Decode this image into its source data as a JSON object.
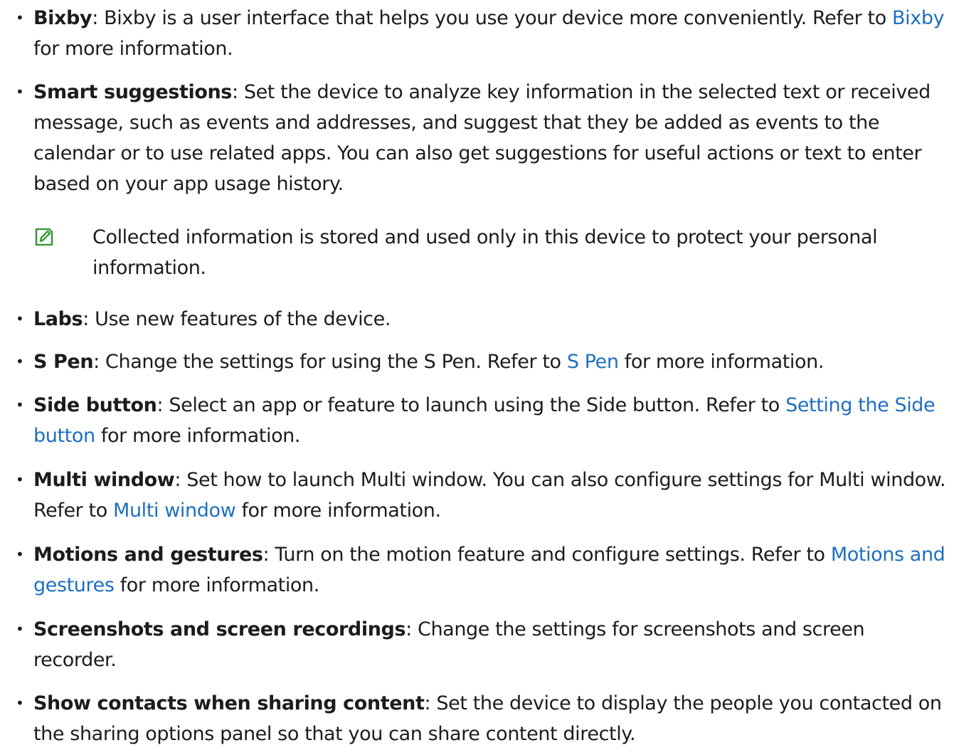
{
  "items": [
    {
      "term": "Bixby",
      "before": ": Bixby is a user interface that helps you use your device more conveniently. Refer to ",
      "link": "Bixby",
      "after": " for more information."
    },
    {
      "term": "Smart suggestions",
      "before": ": Set the device to analyze key information in the selected text or received message, such as events and addresses, and suggest that they be added as events to the calendar or to use related apps. You can also get suggestions for useful actions or text to enter based on your app usage history.",
      "link": "",
      "after": ""
    },
    {
      "term": "Labs",
      "before": ": Use new features of the device.",
      "link": "",
      "after": ""
    },
    {
      "term": "S Pen",
      "before": ": Change the settings for using the S Pen. Refer to ",
      "link": "S Pen",
      "after": " for more information."
    },
    {
      "term": "Side button",
      "before": ": Select an app or feature to launch using the Side button. Refer to ",
      "link": "Setting the Side button",
      "after": " for more information."
    },
    {
      "term": "Multi window",
      "before": ": Set how to launch Multi window. You can also configure settings for Multi window. Refer to ",
      "link": "Multi window",
      "after": " for more information."
    },
    {
      "term": "Motions and gestures",
      "before": ": Turn on the motion feature and configure settings. Refer to ",
      "link": "Motions and gestures",
      "after": " for more information."
    },
    {
      "term": "Screenshots and screen recordings",
      "before": ": Change the settings for screenshots and screen recorder.",
      "link": "",
      "after": ""
    },
    {
      "term": "Show contacts when sharing content",
      "before": ": Set the device to display the people you contacted on the sharing options panel so that you can share content directly.",
      "link": "",
      "after": ""
    }
  ],
  "note": {
    "icon": "note-pencil-icon",
    "text": "Collected information is stored and used only in this device to protect your personal information."
  },
  "colors": {
    "text": "#1c1c1c",
    "link": "#1e6fbf",
    "note_icon": "#3a9a3a"
  }
}
